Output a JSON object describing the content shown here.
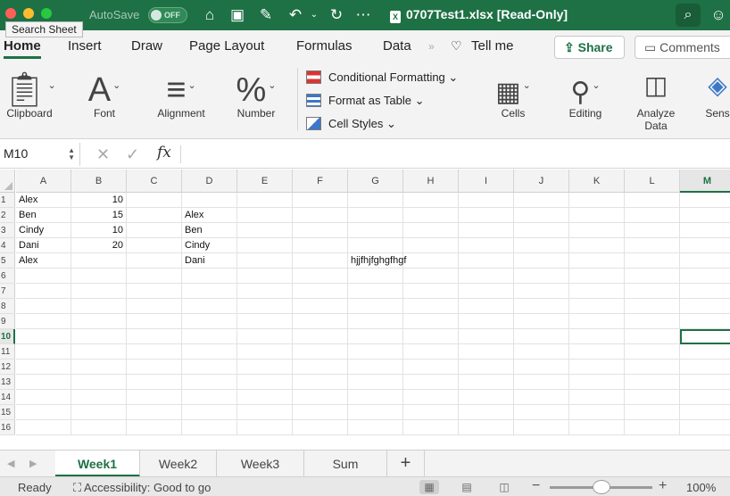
{
  "window": {
    "autosave_label": "AutoSave",
    "autosave_state": "OFF",
    "document_title": "0707Test1.xlsx  [Read-Only]",
    "search_tooltip": "Search Sheet"
  },
  "ribbon_tabs": [
    "Home",
    "Insert",
    "Draw",
    "Page Layout",
    "Formulas",
    "Data",
    "Tell me"
  ],
  "ribbon_actions": {
    "share": "Share",
    "comments": "Comments"
  },
  "ribbon_groups": {
    "clipboard": "Clipboard",
    "font": "Font",
    "alignment": "Alignment",
    "number": "Number",
    "conditional_formatting": "Conditional Formatting",
    "format_as_table": "Format as Table",
    "cell_styles": "Cell Styles",
    "cells": "Cells",
    "editing": "Editing",
    "analyze_data": "Analyze Data",
    "sensitivity": "Sens"
  },
  "formula_bar": {
    "name_box": "M10",
    "fx": "fx",
    "formula": ""
  },
  "columns": [
    "A",
    "B",
    "C",
    "D",
    "E",
    "F",
    "G",
    "H",
    "I",
    "J",
    "K",
    "L",
    "M"
  ],
  "selected_column": "M",
  "selected_row": "10",
  "rows": [
    "1",
    "2",
    "3",
    "4",
    "5",
    "6",
    "7",
    "8",
    "9",
    "10",
    "11",
    "12",
    "13",
    "14",
    "15",
    "16"
  ],
  "cells": {
    "A1": "Alex",
    "B1": "10",
    "A2": "Ben",
    "B2": "15",
    "D2": "Alex",
    "A3": "Cindy",
    "B3": "10",
    "D3": "Ben",
    "A4": "Dani",
    "B4": "20",
    "D4": "Cindy",
    "A5": "Alex",
    "D5": "Dani",
    "G5": "hjjfhjfghgfhgf"
  },
  "sheets": [
    "Week1",
    "Week2",
    "Week3",
    "Sum"
  ],
  "active_sheet": "Week1",
  "status": {
    "ready": "Ready",
    "accessibility": "Accessibility: Good to go",
    "zoom": "100%"
  },
  "colors": {
    "accent": "#1e7145",
    "titlebar": "#1e7145"
  }
}
